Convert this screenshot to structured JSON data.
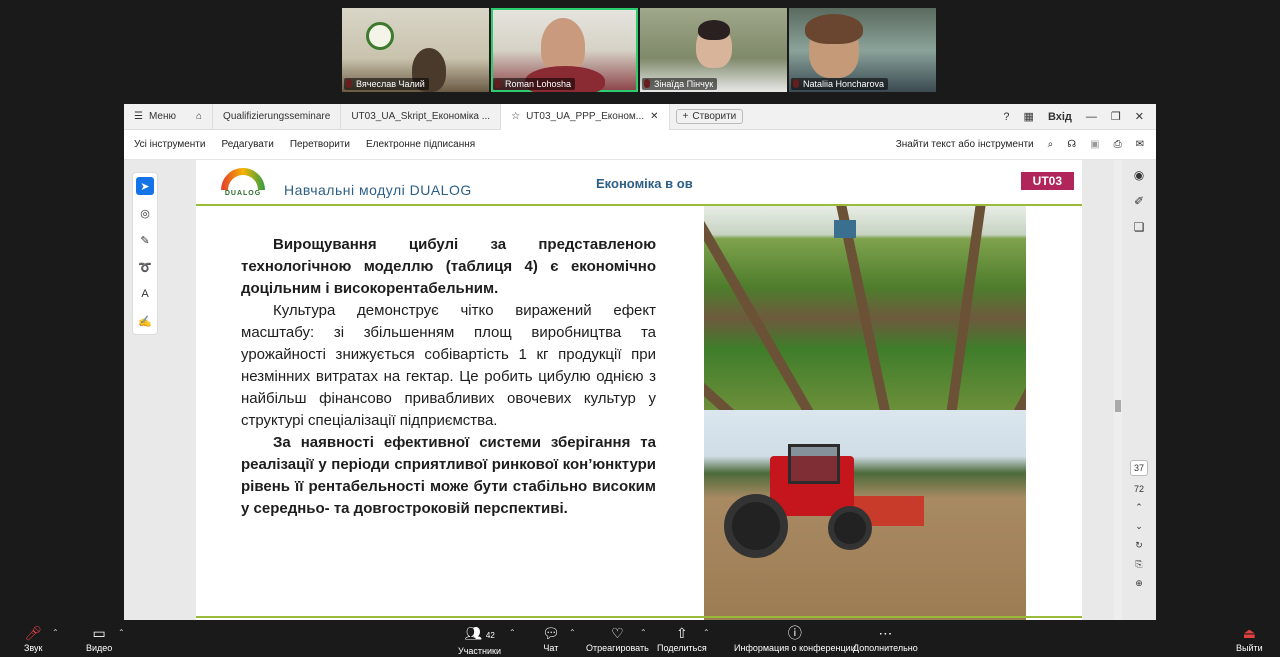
{
  "participants": [
    {
      "name": "Вячеслав Чалий"
    },
    {
      "name": "Roman Lohosha"
    },
    {
      "name": "Зінаїда Пінчук"
    },
    {
      "name": "Nataliia Honcharova"
    }
  ],
  "browser": {
    "menu_label": "Меню",
    "tabs": [
      {
        "label": "Qualifizierungsseminare"
      },
      {
        "label": "UT03_UA_Skript_Економіка ..."
      },
      {
        "label": "UT03_UA_PPP_Економ..."
      }
    ],
    "new_tab_label": "Створити",
    "login_label": "Вхід"
  },
  "toolbar": {
    "all_tools": "Усі інструменти",
    "edit": "Редагувати",
    "convert": "Перетворити",
    "esign": "Електронне підписання",
    "search_label": "Знайти текст або інструменти"
  },
  "slide": {
    "logo_text": "DUALOG",
    "header_title": "Навчальні модулі  DUALOG",
    "header_econ": "Економіка в ов",
    "badge": "UT03",
    "para1": "Вирощування цибулі за представленою технологічною моделлю (таблиця 4) є економічно доцільним і високорентабельним.",
    "para2": "Культура демонструє чітко виражений ефект масштабу: зі збільшенням площ виробництва та урожайності знижується собівартість 1 кг продукції при незмінних витратах на гектар. Це робить цибулю однією з найбільш фінансово привабливих овочевих культур у структурі спеціалізації підприємства.",
    "para3": "За наявності ефективної системи зберігання та реалізації у періоди сприятливої ринкової кон’юнктури рівень її рентабельності може бути стабільно високим у середньо- та довгостроковій перспективі."
  },
  "pages": {
    "current": "37",
    "total": "72"
  },
  "zoom_bar": {
    "audio": "Звук",
    "video": "Видео",
    "participants": "Участники",
    "participants_count": "42",
    "chat": "Чат",
    "react": "Отреагировать",
    "share": "Поделиться",
    "info": "Информация о конференции",
    "more": "Дополнительно",
    "leave": "Выйти"
  }
}
